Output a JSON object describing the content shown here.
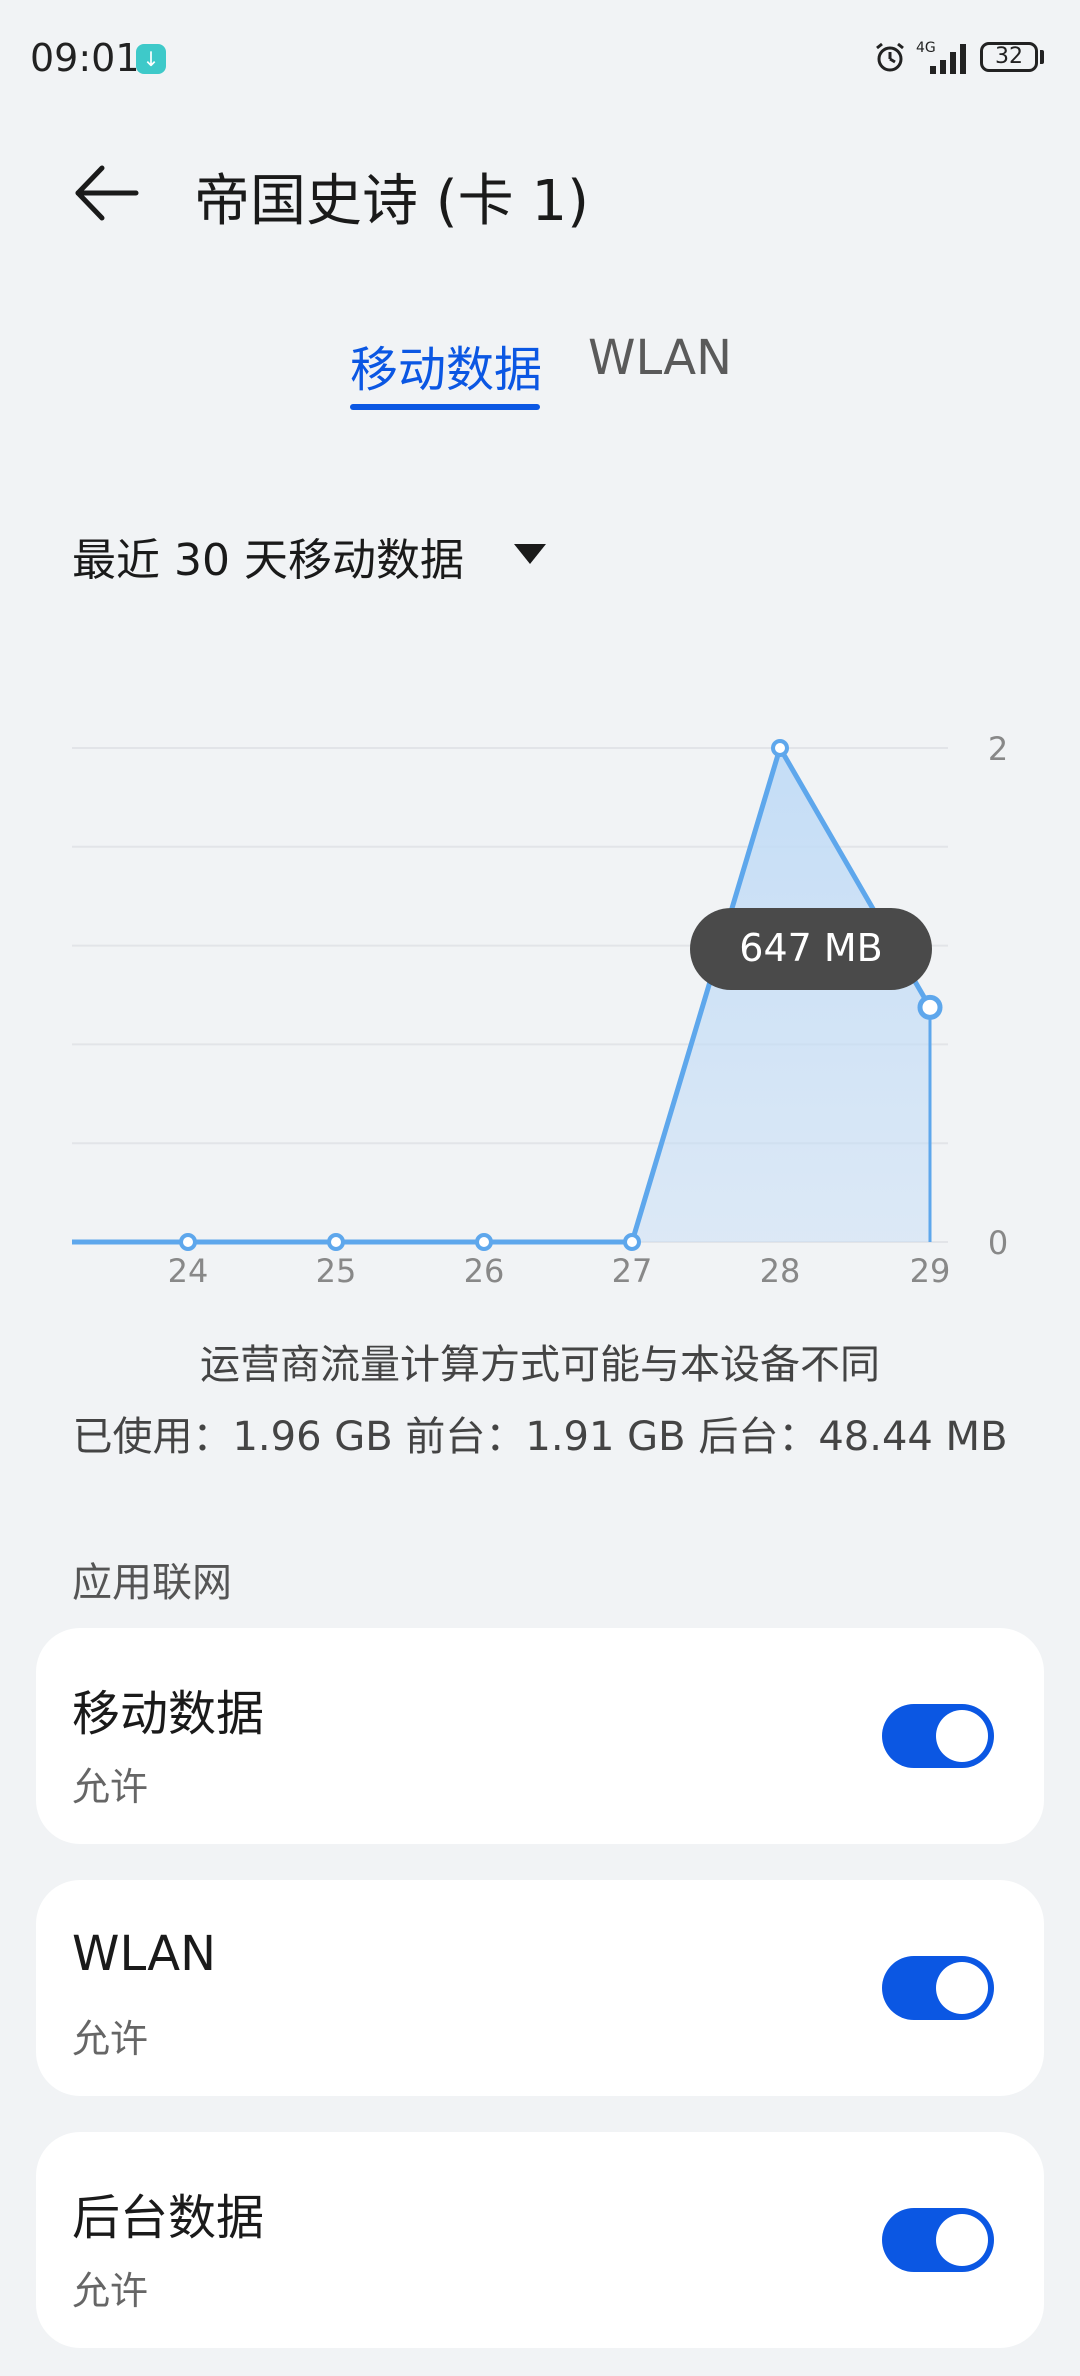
{
  "status_bar": {
    "time": "09:01",
    "network": "4G",
    "battery": "32"
  },
  "header": {
    "title": "帝国史诗 (卡 1)"
  },
  "tabs": [
    {
      "label": "移动数据",
      "active": true
    },
    {
      "label": "WLAN",
      "active": false
    }
  ],
  "period": {
    "label": "最近 30 天移动数据"
  },
  "chart_data": {
    "type": "area",
    "x": [
      23,
      24,
      25,
      26,
      27,
      28,
      29
    ],
    "x_tick_labels": [
      "24",
      "25",
      "26",
      "27",
      "28",
      "29"
    ],
    "y_tick_labels": [
      "2",
      "0"
    ],
    "values": [
      0,
      0,
      0,
      0,
      0,
      2,
      0.95
    ],
    "ylim": [
      0,
      2
    ],
    "grid": true,
    "tooltip": "647 MB",
    "line_color": "#5ea7ec",
    "fill_color": "#c2dcf6"
  },
  "info": {
    "note": "运营商流量计算方式可能与本设备不同",
    "usage": "已使用：1.96 GB 前台：1.91 GB 后台：48.44 MB"
  },
  "section_title": "应用联网",
  "settings": [
    {
      "title": "移动数据",
      "subtitle": "允许",
      "on": true
    },
    {
      "title": "WLAN",
      "subtitle": "允许",
      "on": true
    },
    {
      "title": "后台数据",
      "subtitle": "允许",
      "on": true
    }
  ],
  "colors": {
    "accent": "#0b57e3",
    "background": "#f1f3f5"
  }
}
